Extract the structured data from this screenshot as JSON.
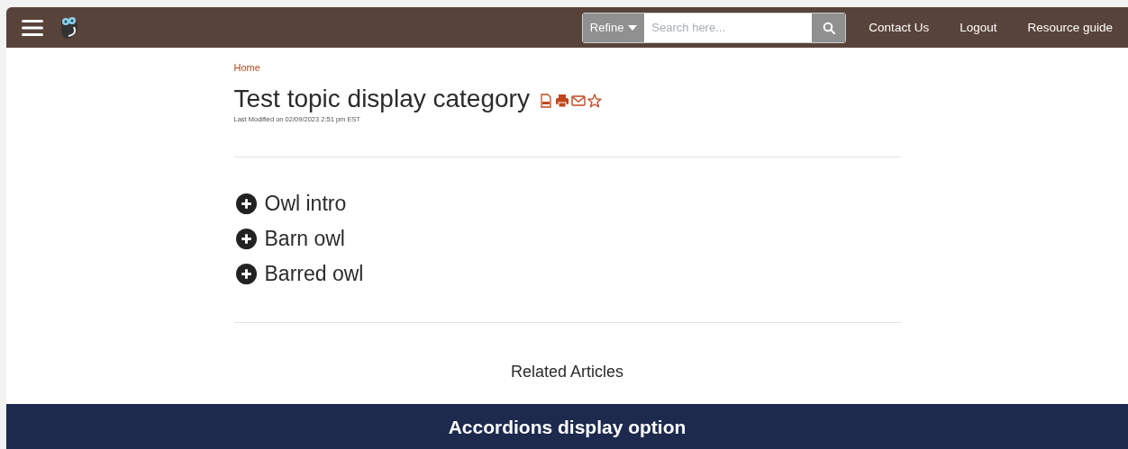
{
  "header": {
    "refine_label": "Refine",
    "search": {
      "placeholder": "Search here..."
    },
    "links": [
      "Contact Us",
      "Logout",
      "Resource guide"
    ]
  },
  "breadcrumb": [
    "Home"
  ],
  "title": "Test topic display category",
  "last_modified": "Last Modified on 02/09/2023 2:51 pm EST",
  "accordions": [
    {
      "label": "Owl intro",
      "expanded": false
    },
    {
      "label": "Barn owl",
      "expanded": false
    },
    {
      "label": "Barred owl",
      "expanded": false
    }
  ],
  "related_heading": "Related Articles",
  "banner": "Accordions display option"
}
